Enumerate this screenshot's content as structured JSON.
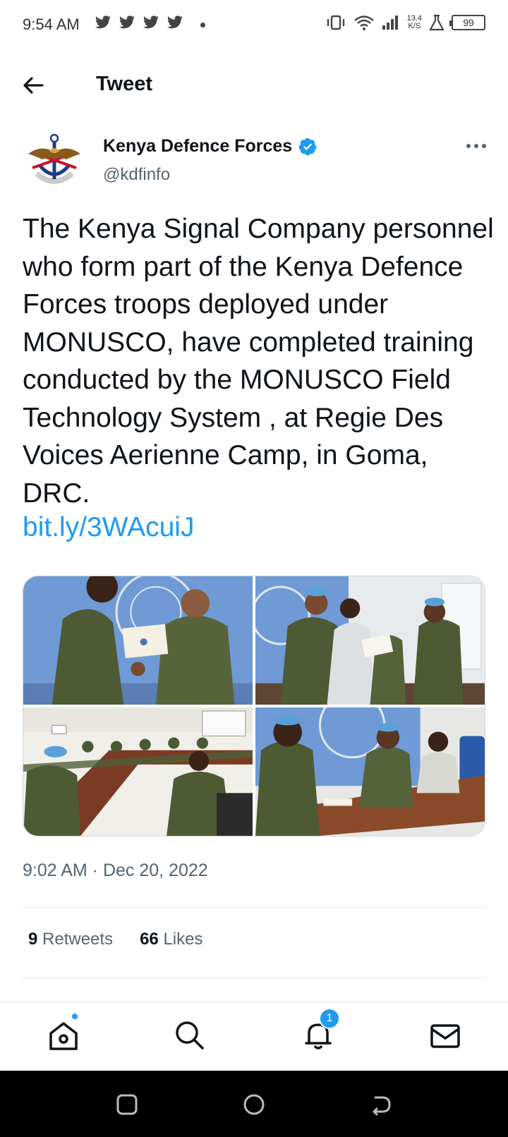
{
  "status_bar": {
    "time": "9:54 AM",
    "net_speed_value": "13.4",
    "net_speed_unit": "K/S",
    "battery": "99"
  },
  "header": {
    "title": "Tweet"
  },
  "author": {
    "name": "Kenya Defence Forces",
    "handle": "@kdfinfo",
    "verified_icon": "verified-badge-icon"
  },
  "tweet": {
    "text": "The Kenya Signal Company personnel who form part of the Kenya Defence Forces troops deployed under MONUSCO, have completed training conducted by the MONUSCO Field Technology System , at Regie Des Voices Aerienne  Camp, in Goma, DRC.",
    "link": "bit.ly/3WAcuiJ",
    "link_color": "#1d9bf0"
  },
  "meta": {
    "timestamp": "9:02 AM · Dec 20, 2022"
  },
  "stats": {
    "retweets_count": "9",
    "retweets_label": "Retweets",
    "likes_count": "66",
    "likes_label": "Likes"
  },
  "bottom_nav": {
    "notification_badge": "1",
    "items": [
      "home-icon",
      "search-icon",
      "notifications-icon",
      "messages-icon"
    ]
  },
  "colors": {
    "accent": "#1d9bf0",
    "secondary_text": "#536471"
  }
}
